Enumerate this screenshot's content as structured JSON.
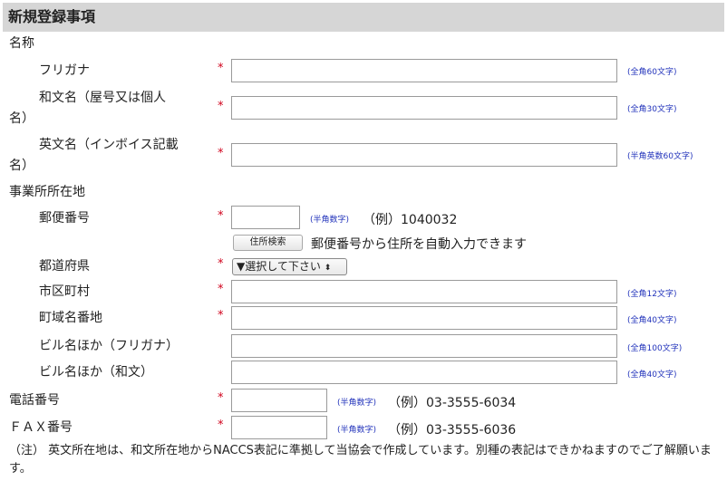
{
  "section_title": "新規登録事項",
  "name_group": "名称",
  "address_group": "事業所所在地",
  "required_mark": "*",
  "fields": {
    "furigana": {
      "label": "フリガナ",
      "hint": "(全角60文字)",
      "value": ""
    },
    "japanese_name": {
      "label_line1": "和文名（屋号又は個人",
      "label_line2": "名）",
      "hint": "(全角30文字)",
      "value": ""
    },
    "english_name": {
      "label_line1": "英文名（インボイス記載",
      "label_line2": "名）",
      "hint": "(半角英数60文字)",
      "value": ""
    },
    "postal_code": {
      "label": "郵便番号",
      "hint": "(半角数字)",
      "example": "（例）1040032",
      "value": ""
    },
    "address_search": {
      "button": "住所検索",
      "description": "郵便番号から住所を自動入力できます"
    },
    "prefecture": {
      "label": "都道府県",
      "selected": "▼選択して下さい"
    },
    "city": {
      "label": "市区町村",
      "hint": "(全角12文字)",
      "value": ""
    },
    "town": {
      "label": "町域名番地",
      "hint": "(全角40文字)",
      "value": ""
    },
    "building_kana": {
      "label": "ビル名ほか（フリガナ）",
      "hint": "(全角100文字)",
      "value": ""
    },
    "building": {
      "label": "ビル名ほか（和文）",
      "hint": "(全角40文字)",
      "value": ""
    },
    "phone": {
      "label": "電話番号",
      "hint": "(半角数字)",
      "example": "（例）03-3555-6034",
      "value": ""
    },
    "fax": {
      "label": "ＦＡＸ番号",
      "hint": "(半角数字)",
      "example": "（例）03-3555-6036",
      "value": ""
    }
  },
  "note_line1": "（注） 英文所在地は、和文所在地からNACCS表記に準拠して当協会で作成しています。別種の表記はできかねますのでご了解願いま",
  "note_line2": "す。"
}
